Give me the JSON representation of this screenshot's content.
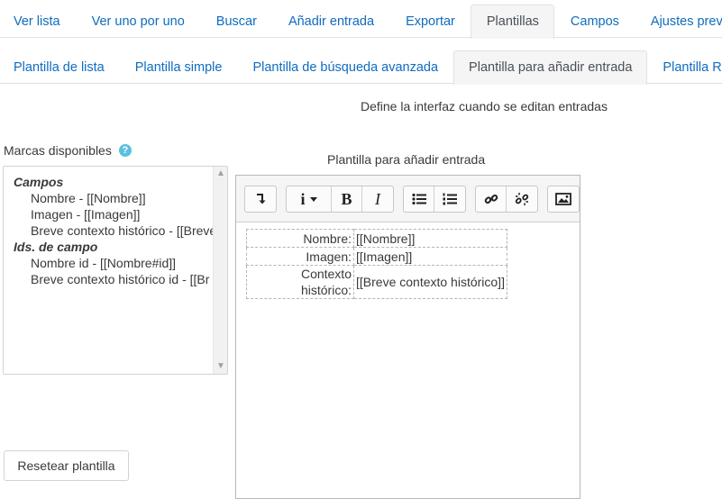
{
  "primary_tabs": [
    "Ver lista",
    "Ver uno por uno",
    "Buscar",
    "Añadir entrada",
    "Exportar",
    "Plantillas",
    "Campos",
    "Ajustes previos"
  ],
  "primary_active": "Plantillas",
  "secondary_tabs": [
    "Plantilla de lista",
    "Plantilla simple",
    "Plantilla de búsqueda avanzada",
    "Plantilla para añadir entrada",
    "Plantilla RSS"
  ],
  "secondary_active": "Plantilla para añadir entrada",
  "intro": "Define la interfaz cuando se editan entradas",
  "available_tags": {
    "label": "Marcas disponibles",
    "groups": [
      {
        "title": "Campos",
        "items": [
          "Nombre - [[Nombre]]",
          "Imagen - [[Imagen]]",
          "Breve contexto histórico - [[Breve"
        ]
      },
      {
        "title": "Ids. de campo",
        "items": [
          "Nombre id - [[Nombre#id]]",
          "Breve contexto histórico id - [[Br"
        ]
      }
    ]
  },
  "reset_button": "Resetear plantilla",
  "editor": {
    "title": "Plantilla para añadir entrada",
    "toolbar": {
      "bold": "B",
      "italic": "I",
      "info": "i"
    },
    "rows": [
      {
        "label": "Nombre:",
        "value": "[[Nombre]]"
      },
      {
        "label": "Imagen:",
        "value": "[[Imagen]]"
      },
      {
        "label": "Contexto histórico:",
        "value": "[[Breve contexto histórico]]"
      }
    ]
  },
  "colors": {
    "link": "#0f6cbf",
    "help": "#5bc0de"
  }
}
